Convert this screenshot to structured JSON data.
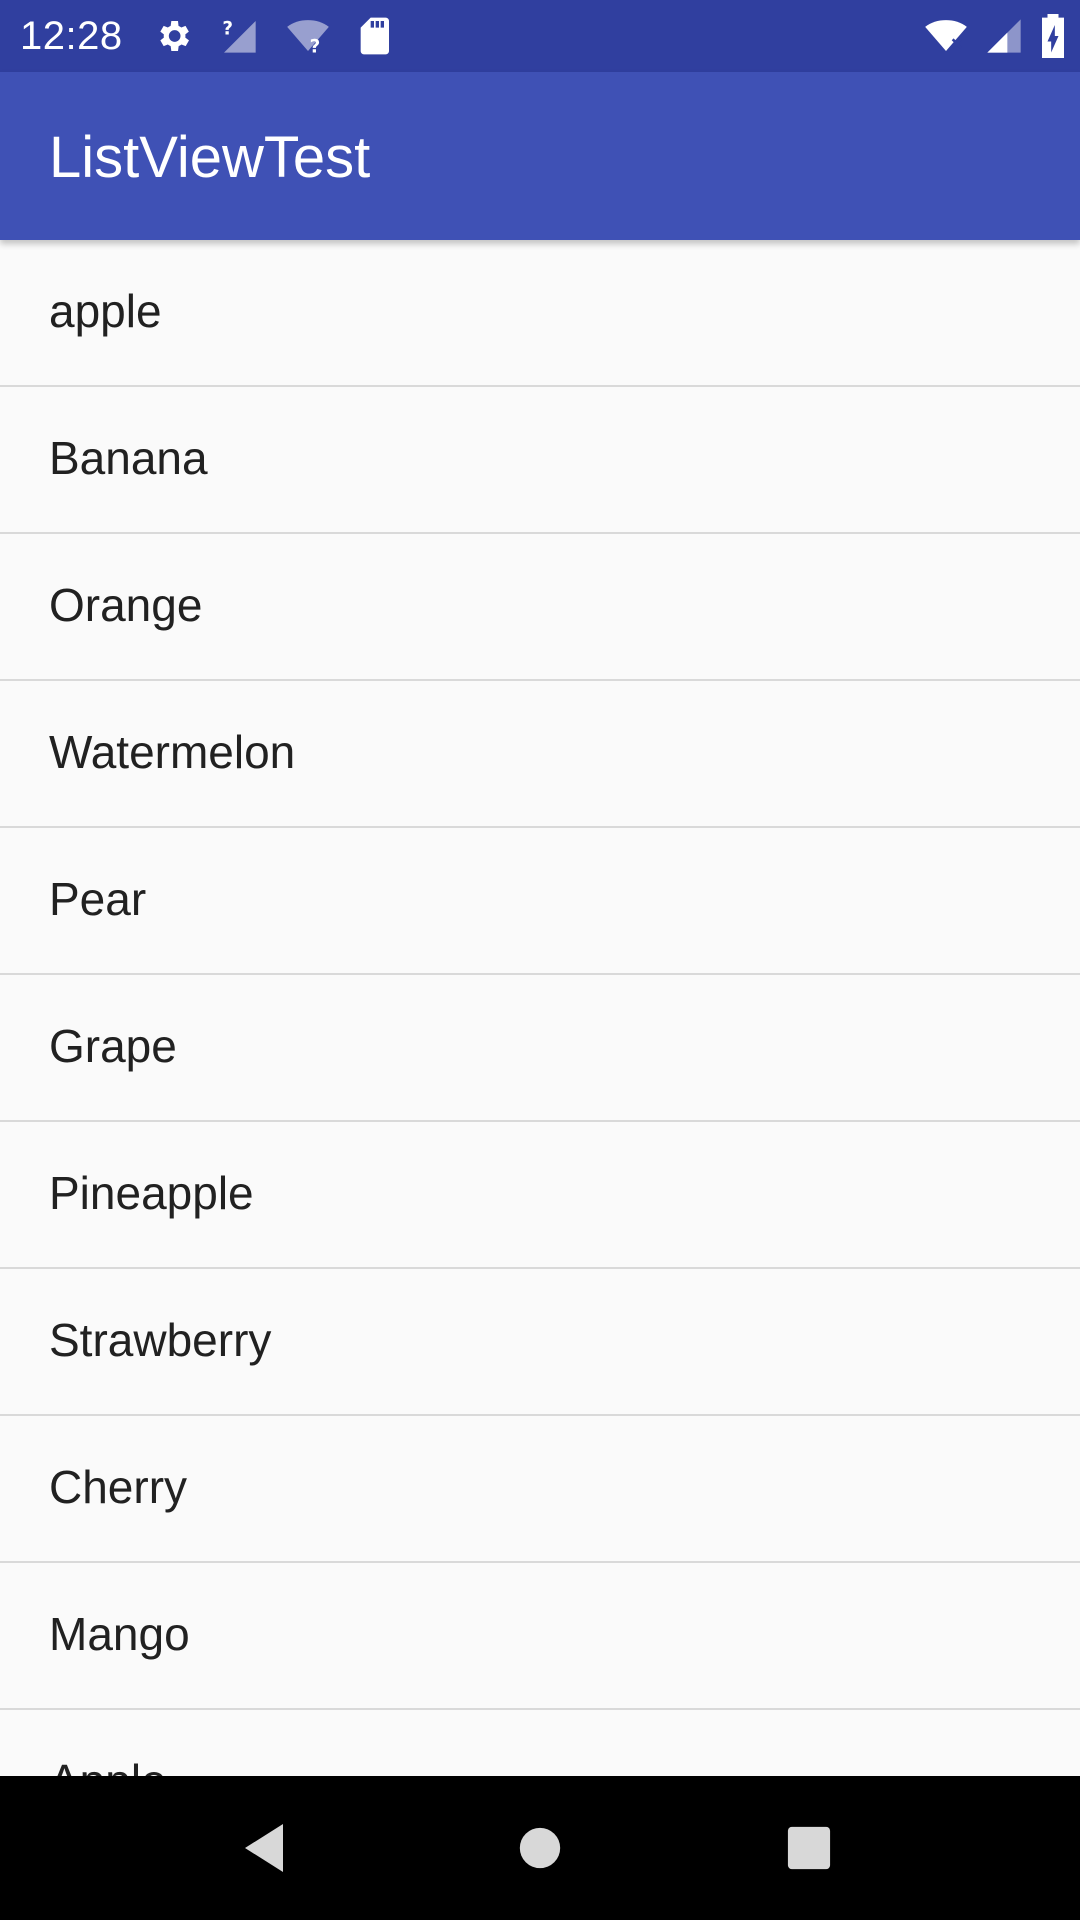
{
  "status_bar": {
    "time": "12:28",
    "left_icons": [
      "settings-icon",
      "no-signal-icon",
      "wifi-unknown-icon",
      "sd-card-icon"
    ],
    "right_icons": [
      "wifi-icon",
      "signal-icon",
      "battery-charging-icon"
    ]
  },
  "app_bar": {
    "title": "ListViewTest",
    "color": "#3f51b5"
  },
  "list": {
    "items": [
      {
        "label": "apple"
      },
      {
        "label": "Banana"
      },
      {
        "label": "Orange"
      },
      {
        "label": "Watermelon"
      },
      {
        "label": "Pear"
      },
      {
        "label": "Grape"
      },
      {
        "label": "Pineapple"
      },
      {
        "label": "Strawberry"
      },
      {
        "label": "Cherry"
      },
      {
        "label": "Mango"
      },
      {
        "label": "Apple"
      }
    ]
  },
  "nav_bar": {
    "buttons": [
      "back-icon",
      "home-icon",
      "recents-icon"
    ]
  },
  "colors": {
    "status_bar": "#303f9f",
    "app_bar": "#3f51b5",
    "background": "#fafafa",
    "divider": "#d9d9d9"
  }
}
